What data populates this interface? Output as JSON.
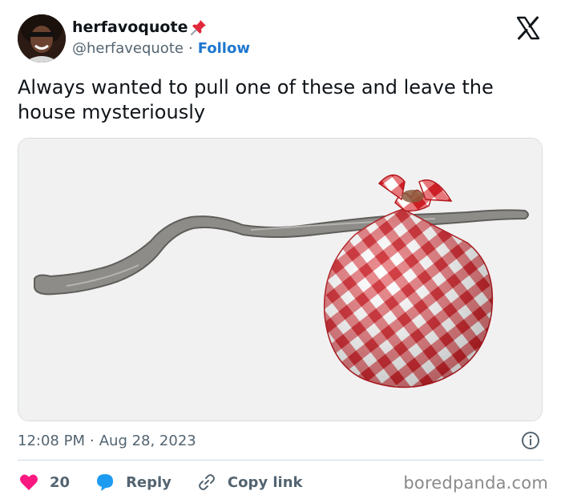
{
  "user": {
    "display_name": "herfavoquote",
    "handle": "@herfavequote",
    "separator": "·",
    "follow_label": "Follow"
  },
  "tweet": {
    "text": "Always wanted to pull one of these and leave the house mysteriously",
    "time": "12:08 PM",
    "date_separator": "·",
    "date": "Aug 28, 2023",
    "media_description": "bindle-stick-with-red-gingham-bundle"
  },
  "actions": {
    "like_count": "20",
    "reply_label": "Reply",
    "copy_link_label": "Copy link"
  },
  "icons": {
    "pin": "pushpin-icon",
    "x": "x-logo-icon",
    "info": "info-icon",
    "like": "heart-icon",
    "reply": "speech-bubble-icon",
    "link": "link-icon"
  },
  "colors": {
    "accent": "#1d77cf",
    "heart": "#f91880",
    "reply": "#1d9bf0",
    "gingham": "#d8232a"
  },
  "watermark": "boredpanda.com"
}
